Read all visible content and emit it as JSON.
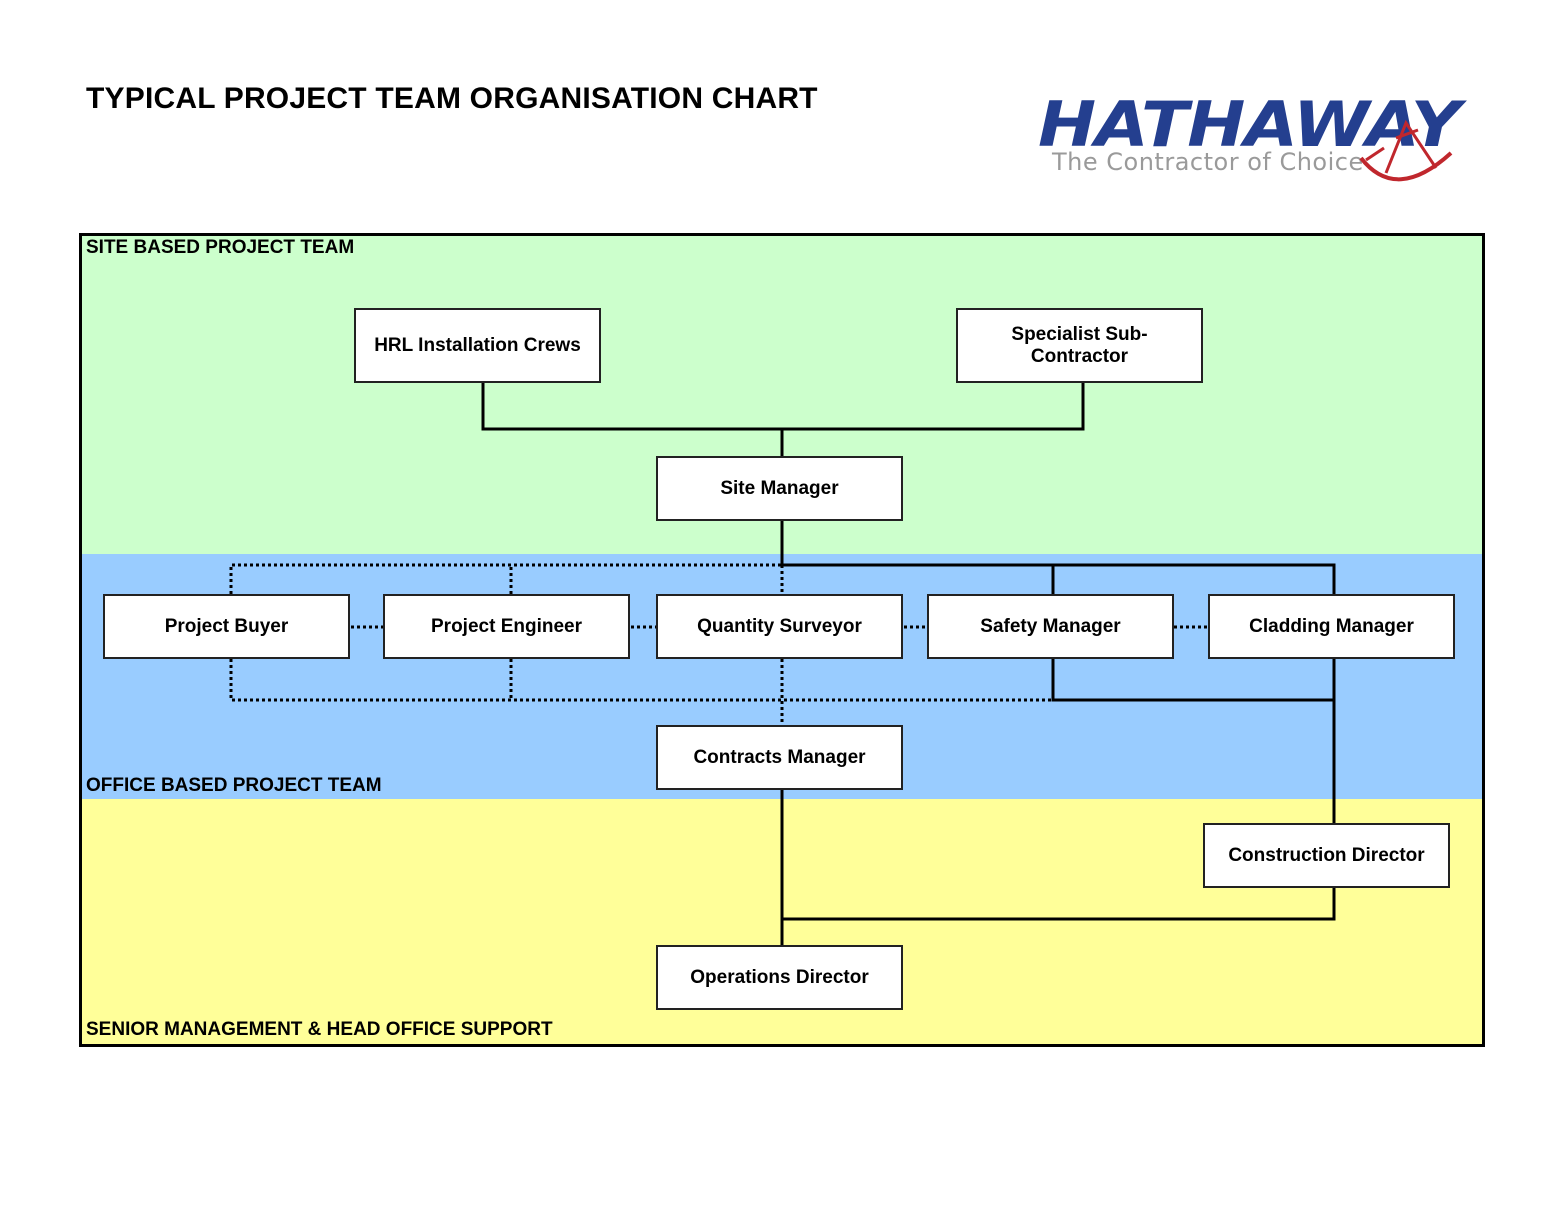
{
  "title": "TYPICAL PROJECT TEAM ORGANISATION CHART",
  "logo": {
    "wordmark": "HATHAWAY",
    "tagline": "The Contractor of Choice",
    "brand_color": "#243f8f",
    "accent_color": "#c0272d",
    "tagline_color": "#9a9a9a"
  },
  "bands": {
    "site": {
      "label": "SITE BASED PROJECT TEAM",
      "color": "#ccffcc"
    },
    "office": {
      "label": "OFFICE BASED PROJECT TEAM",
      "color": "#99ccff"
    },
    "senior": {
      "label": "SENIOR MANAGEMENT & HEAD OFFICE SUPPORT",
      "color": "#ffff99"
    }
  },
  "nodes": {
    "hrl_crews": "HRL Installation Crews",
    "specialist": "Specialist Sub-\nContractor",
    "site_manager": "Site Manager",
    "project_buyer": "Project Buyer",
    "project_engineer": "Project Engineer",
    "quantity_surveyor": "Quantity Surveyor",
    "safety_manager": "Safety Manager",
    "cladding_manager": "Cladding Manager",
    "contracts_manager": "Contracts Manager",
    "construction_director": "Construction Director",
    "operations_director": "Operations Director"
  },
  "connections": {
    "solid": [
      [
        "hrl_crews",
        "site_manager"
      ],
      [
        "specialist",
        "site_manager"
      ],
      [
        "site_manager",
        "safety_manager"
      ],
      [
        "site_manager",
        "cladding_manager"
      ],
      [
        "safety_manager",
        "construction_director"
      ],
      [
        "cladding_manager",
        "construction_director"
      ],
      [
        "contracts_manager",
        "operations_director"
      ],
      [
        "construction_director",
        "operations_director"
      ]
    ],
    "dotted": [
      [
        "site_manager",
        "project_buyer"
      ],
      [
        "site_manager",
        "project_engineer"
      ],
      [
        "site_manager",
        "quantity_surveyor"
      ],
      [
        "project_buyer",
        "project_engineer"
      ],
      [
        "project_engineer",
        "quantity_surveyor"
      ],
      [
        "quantity_surveyor",
        "safety_manager"
      ],
      [
        "safety_manager",
        "cladding_manager"
      ],
      [
        "project_buyer",
        "contracts_manager"
      ],
      [
        "project_engineer",
        "contracts_manager"
      ],
      [
        "quantity_surveyor",
        "contracts_manager"
      ]
    ]
  }
}
